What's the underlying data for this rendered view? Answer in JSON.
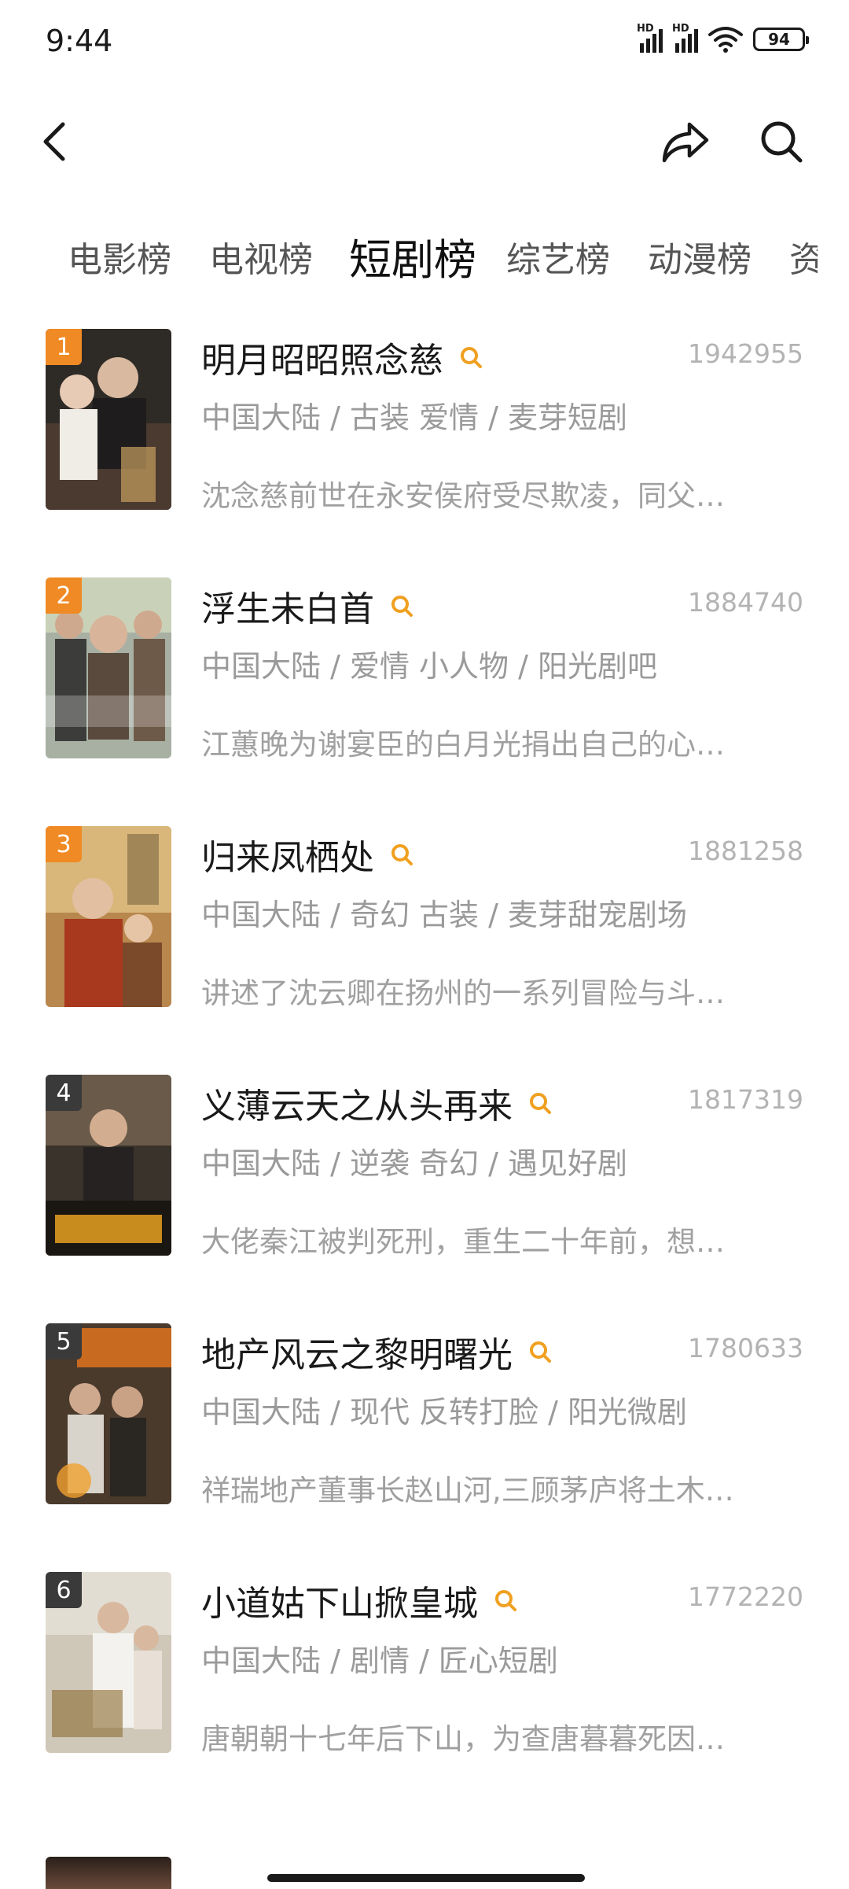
{
  "status_bar": {
    "time": "9:44",
    "battery": "94",
    "signal1": "HD",
    "signal2": "HD"
  },
  "header": {
    "back_icon": "back-arrow-icon",
    "share_icon": "share-icon",
    "search_icon": "search-icon"
  },
  "tabs": [
    {
      "label": "电影榜",
      "active": false
    },
    {
      "label": "电视榜",
      "active": false
    },
    {
      "label": "短剧榜",
      "active": true
    },
    {
      "label": "综艺榜",
      "active": false
    },
    {
      "label": "动漫榜",
      "active": false
    },
    {
      "label": "资",
      "active": false
    }
  ],
  "colors": {
    "rank_top": "#f08a24",
    "rank_other": "#3a3a3a",
    "search_accent": "#f0a020"
  },
  "items": [
    {
      "rank": "1",
      "title": "明月昭昭照念慈",
      "score": "1942955",
      "meta": "中国大陆 / 古装 爱情 / 麦芽短剧",
      "desc": "沈念慈前世在永安侯府受尽欺凌，同父…"
    },
    {
      "rank": "2",
      "title": "浮生未白首",
      "score": "1884740",
      "meta": "中国大陆 / 爱情 小人物 / 阳光剧吧",
      "desc": "江蕙晚为谢宴臣的白月光捐出自己的心…"
    },
    {
      "rank": "3",
      "title": "归来凤栖处",
      "score": "1881258",
      "meta": "中国大陆 / 奇幻 古装 / 麦芽甜宠剧场",
      "desc": "讲述了沈云卿在扬州的一系列冒险与斗…"
    },
    {
      "rank": "4",
      "title": "义薄云天之从头再来",
      "score": "1817319",
      "meta": "中国大陆 / 逆袭 奇幻 / 遇见好剧",
      "desc": "大佬秦江被判死刑，重生二十年前，想…"
    },
    {
      "rank": "5",
      "title": "地产风云之黎明曙光",
      "score": "1780633",
      "meta": "中国大陆 / 现代 反转打脸 / 阳光微剧",
      "desc": "祥瑞地产董事长赵山河,三顾茅庐将土木…"
    },
    {
      "rank": "6",
      "title": "小道姑下山掀皇城",
      "score": "1772220",
      "meta": "中国大陆 / 剧情 / 匠心短剧",
      "desc": "唐朝朝十七年后下山，为查唐暮暮死因…"
    }
  ]
}
